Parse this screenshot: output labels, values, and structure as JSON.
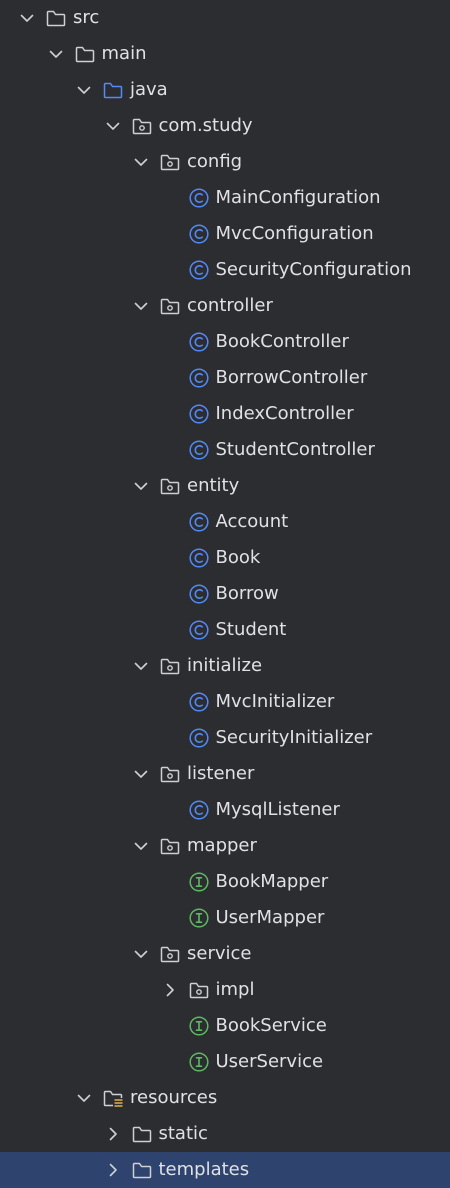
{
  "tree": [
    {
      "label": "src",
      "depth": 0,
      "icon": "folder",
      "chevron": "down"
    },
    {
      "label": "main",
      "depth": 1,
      "icon": "folder",
      "chevron": "down"
    },
    {
      "label": "java",
      "depth": 2,
      "icon": "source-folder",
      "chevron": "down"
    },
    {
      "label": "com.study",
      "depth": 3,
      "icon": "package",
      "chevron": "down"
    },
    {
      "label": "config",
      "depth": 4,
      "icon": "package",
      "chevron": "down"
    },
    {
      "label": "MainConfiguration",
      "depth": 5,
      "icon": "class"
    },
    {
      "label": "MvcConfiguration",
      "depth": 5,
      "icon": "class"
    },
    {
      "label": "SecurityConfiguration",
      "depth": 5,
      "icon": "class"
    },
    {
      "label": "controller",
      "depth": 4,
      "icon": "package",
      "chevron": "down"
    },
    {
      "label": "BookController",
      "depth": 5,
      "icon": "class"
    },
    {
      "label": "BorrowController",
      "depth": 5,
      "icon": "class"
    },
    {
      "label": "IndexController",
      "depth": 5,
      "icon": "class"
    },
    {
      "label": "StudentController",
      "depth": 5,
      "icon": "class"
    },
    {
      "label": "entity",
      "depth": 4,
      "icon": "package",
      "chevron": "down"
    },
    {
      "label": "Account",
      "depth": 5,
      "icon": "class"
    },
    {
      "label": "Book",
      "depth": 5,
      "icon": "class"
    },
    {
      "label": "Borrow",
      "depth": 5,
      "icon": "class"
    },
    {
      "label": "Student",
      "depth": 5,
      "icon": "class"
    },
    {
      "label": "initialize",
      "depth": 4,
      "icon": "package",
      "chevron": "down"
    },
    {
      "label": "MvcInitializer",
      "depth": 5,
      "icon": "class"
    },
    {
      "label": "SecurityInitializer",
      "depth": 5,
      "icon": "class"
    },
    {
      "label": "listener",
      "depth": 4,
      "icon": "package",
      "chevron": "down"
    },
    {
      "label": "MysqlListener",
      "depth": 5,
      "icon": "class"
    },
    {
      "label": "mapper",
      "depth": 4,
      "icon": "package",
      "chevron": "down"
    },
    {
      "label": "BookMapper",
      "depth": 5,
      "icon": "interface"
    },
    {
      "label": "UserMapper",
      "depth": 5,
      "icon": "interface"
    },
    {
      "label": "service",
      "depth": 4,
      "icon": "package",
      "chevron": "down"
    },
    {
      "label": "impl",
      "depth": 5,
      "icon": "package",
      "chevron": "right"
    },
    {
      "label": "BookService",
      "depth": 5,
      "icon": "interface"
    },
    {
      "label": "UserService",
      "depth": 5,
      "icon": "interface"
    },
    {
      "label": "resources",
      "depth": 2,
      "icon": "resources-folder",
      "chevron": "down"
    },
    {
      "label": "static",
      "depth": 3,
      "icon": "folder",
      "chevron": "right"
    },
    {
      "label": "templates",
      "depth": 3,
      "icon": "folder",
      "chevron": "right",
      "selected": true
    }
  ],
  "colors": {
    "background": "#2b2d30",
    "text": "#dfe1e5",
    "selection": "#2e436e",
    "chevron": "#ced0d6",
    "folder": "#ced0d6",
    "source_folder": "#548af7",
    "class_icon": "#548af7",
    "interface_icon": "#5fb865",
    "resources_lines": "#e0b04b"
  }
}
